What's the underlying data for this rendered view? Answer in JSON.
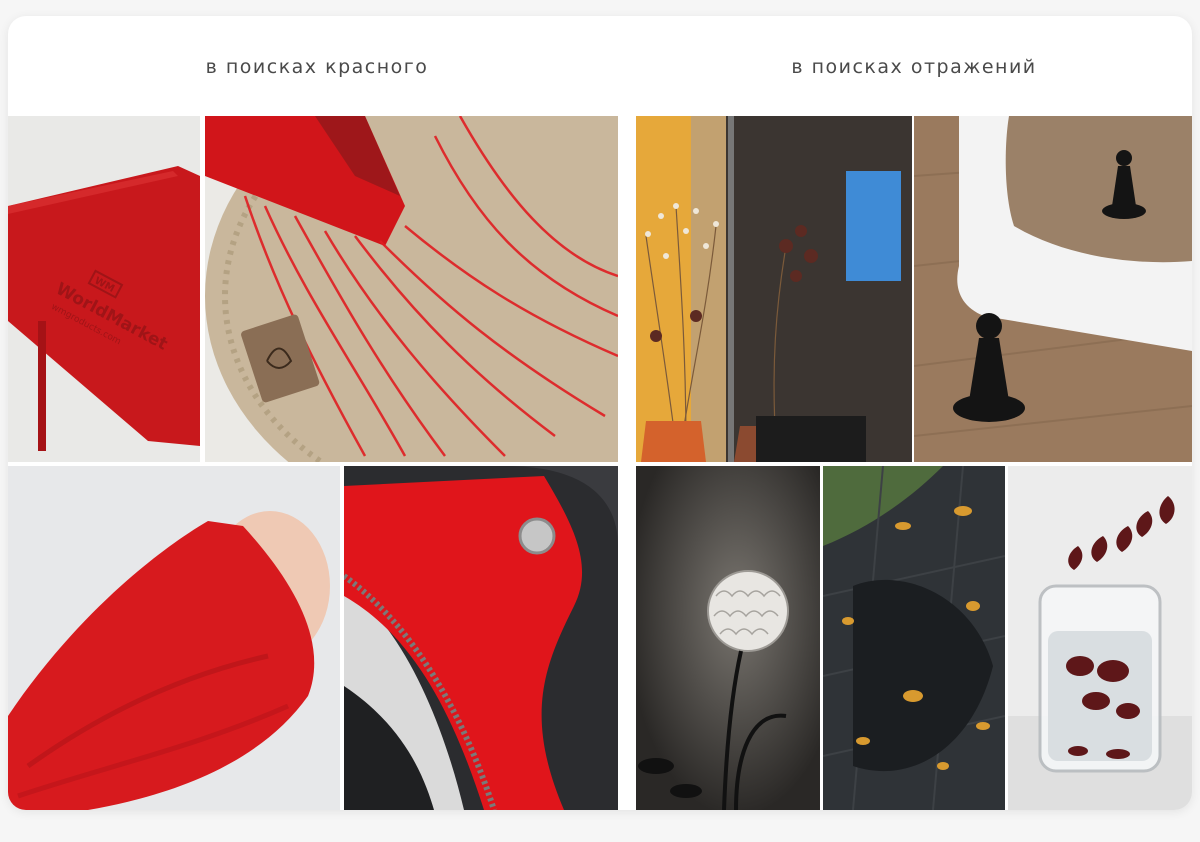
{
  "collage": {
    "left_title": "в поисках красного",
    "right_title": "в поисках отражений",
    "photos_left": [
      "red-notebook",
      "red-scarf-on-jute",
      "red-sweater-sleeve",
      "red-lined-bag"
    ],
    "photos_right": [
      "mirror-with-flowers",
      "chess-pawn-mirror",
      "glass-ball-lamp",
      "puddle-leaves",
      "glass-with-leaves"
    ]
  },
  "notebook_emboss": {
    "logo": "WM",
    "brand": "WorldMarket",
    "site": "wmgroducts.com"
  },
  "colors": {
    "accent_red": "#d4171c",
    "caption_text": "#4a4a4a",
    "card_bg": "#ffffff"
  }
}
